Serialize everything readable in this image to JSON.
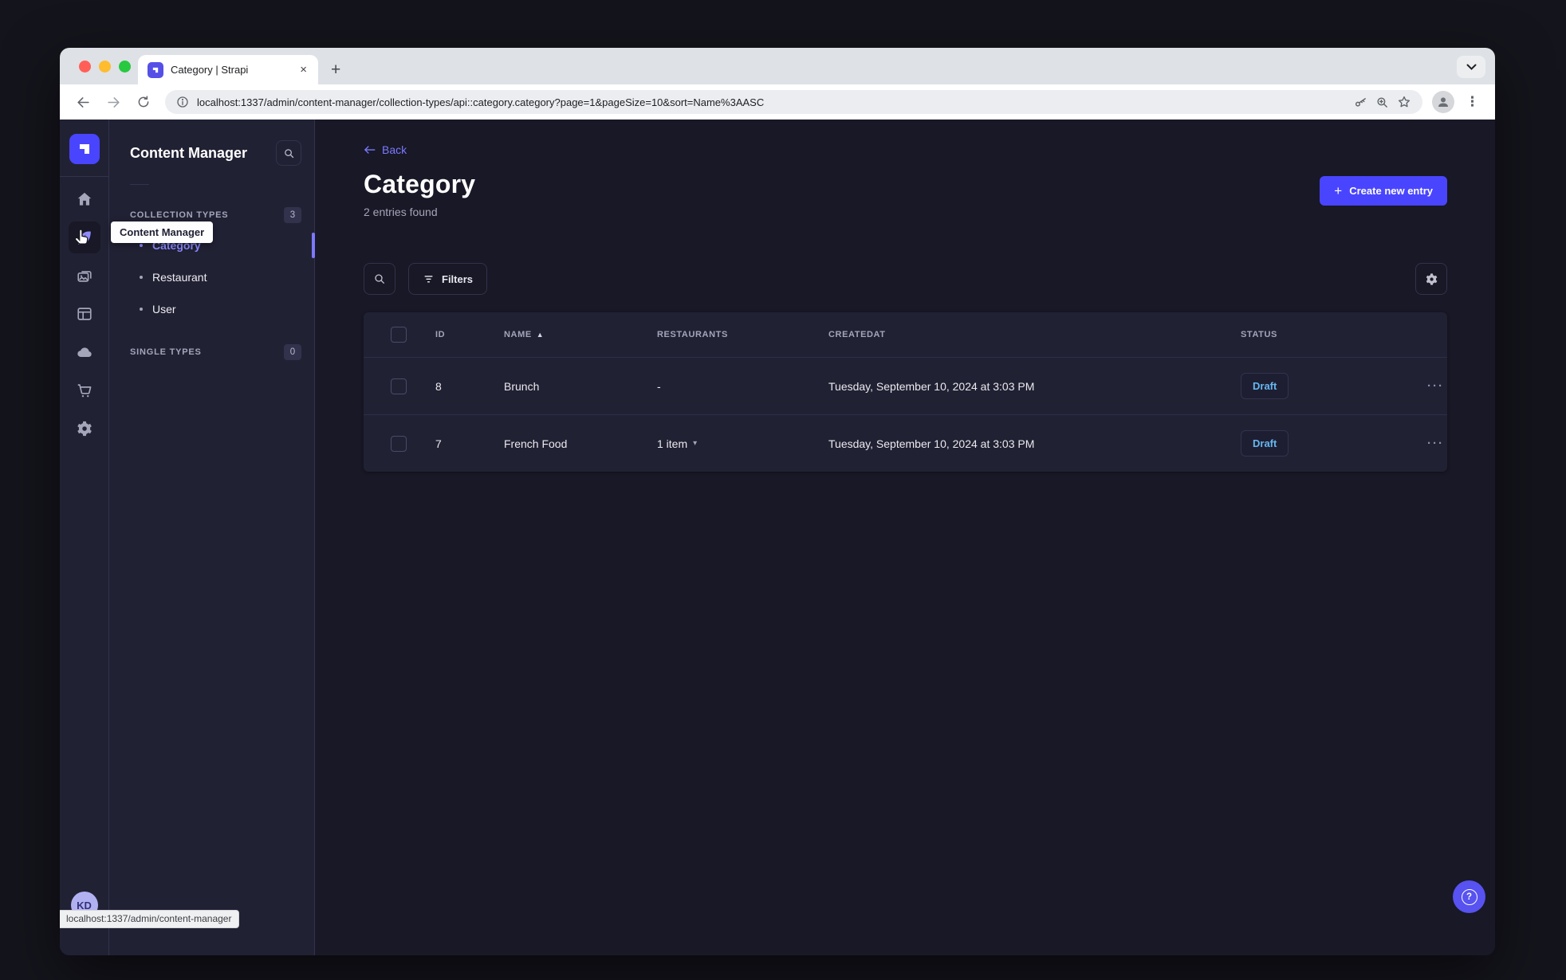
{
  "browser": {
    "tab_title": "Category | Strapi",
    "close_tab_label": "×",
    "new_tab_label": "+",
    "url": "localhost:1337/admin/content-manager/collection-types/api::category.category?page=1&pageSize=10&sort=Name%3AASC",
    "status_tooltip": "localhost:1337/admin/content-manager",
    "menu_dots": "⋮",
    "icons": [
      "traffic-light-close",
      "traffic-light-minimize",
      "traffic-light-zoom",
      "strapi-favicon",
      "close-tab-icon",
      "new-tab-icon",
      "tab-search-chevron-icon",
      "back-arrow-icon",
      "forward-arrow-icon",
      "reload-icon",
      "page-info-icon",
      "password-key-icon",
      "zoom-in-icon",
      "bookmark-star-icon",
      "profile-avatar-icon",
      "browser-menu-icon"
    ]
  },
  "app": {
    "colors": {
      "primary": "#4945ff",
      "primary_light": "#7b79ff",
      "background": "#181826",
      "surface": "#212134",
      "border": "#32324d",
      "text_secondary": "#a5a5ba",
      "draft_status": "#66b7f1"
    },
    "sidebar": {
      "icons": [
        "strapi-logo-icon",
        "home-icon",
        "content-manager-icon",
        "media-library-icon",
        "content-type-builder-icon",
        "cloud-icon",
        "marketplace-icon",
        "settings-icon"
      ],
      "active_icon": "content-manager-icon",
      "tooltip": "Content Manager",
      "avatar_initials": "KD"
    },
    "subnav": {
      "title": "Content Manager",
      "sections": [
        {
          "label": "COLLECTION TYPES",
          "badge": "3",
          "items": [
            {
              "label": "Category",
              "active": true
            },
            {
              "label": "Restaurant",
              "active": false
            },
            {
              "label": "User",
              "active": false
            }
          ]
        },
        {
          "label": "SINGLE TYPES",
          "badge": "0",
          "items": []
        }
      ]
    },
    "main": {
      "back_label": "Back",
      "title": "Category",
      "subtitle": "2 entries found",
      "create_button_label": "Create new entry",
      "create_button_plus": "+",
      "filters_button_label": "Filters",
      "table": {
        "headers": [
          "ID",
          "NAME",
          "RESTAURANTS",
          "CREATEDAT",
          "STATUS"
        ],
        "sorted_by": "NAME",
        "sort_direction": "ASC",
        "rows": [
          {
            "id": "8",
            "name": "Brunch",
            "restaurants": "-",
            "has_dropdown": false,
            "createdAt": "Tuesday, September 10, 2024 at 3:03 PM",
            "status": "Draft",
            "more": "···"
          },
          {
            "id": "7",
            "name": "French Food",
            "restaurants": "1 item",
            "has_dropdown": true,
            "createdAt": "Tuesday, September 10, 2024 at 3:03 PM",
            "status": "Draft",
            "more": "···"
          }
        ]
      }
    }
  }
}
